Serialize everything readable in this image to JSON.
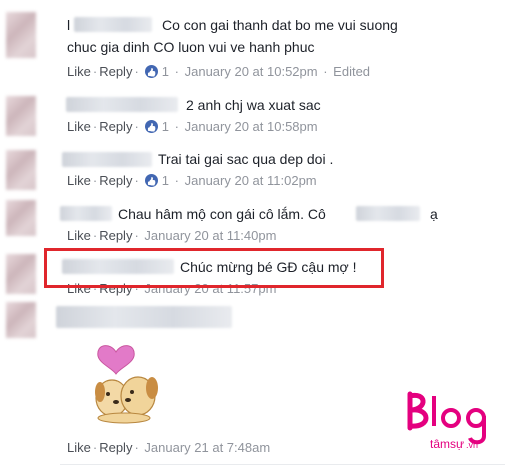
{
  "comments": [
    {
      "lines": [
        "Co con gai thanh dat bo me vui suong",
        "chuc gia dinh CO luon vui ve hanh phuc"
      ],
      "like": "Like",
      "reply": "Reply",
      "reactions": "1",
      "time": "January 20 at 10:52pm",
      "edited": "Edited",
      "name_prefix": "l"
    },
    {
      "lines": [
        "2 anh chj wa xuat sac"
      ],
      "like": "Like",
      "reply": "Reply",
      "reactions": "1",
      "time": "January 20 at 10:58pm"
    },
    {
      "lines": [
        "Trai tai gai sac qua dep doi ."
      ],
      "like": "Like",
      "reply": "Reply",
      "reactions": "1",
      "time": "January 20 at 11:02pm"
    },
    {
      "lines": [
        "Chau hâm mộ con gái cô lắm. Cô"
      ],
      "suffix": "ạ",
      "like": "Like",
      "reply": "Reply",
      "time": "January 20 at 11:40pm"
    },
    {
      "lines": [
        "Chúc mừng bé GĐ cậu mợ !"
      ],
      "like": "Like",
      "reply": "Reply",
      "time": "January 20 at 11:57pm"
    },
    {
      "like": "Like",
      "reply": "Reply",
      "time": "January 21 at 7:48am"
    }
  ],
  "logo": {
    "main": "Blog",
    "sub": "tâmsự",
    "tld": ".vn"
  },
  "colors": {
    "highlight": "#e0262c",
    "like_badge": "#4267b2",
    "logo": "#e4007f"
  }
}
